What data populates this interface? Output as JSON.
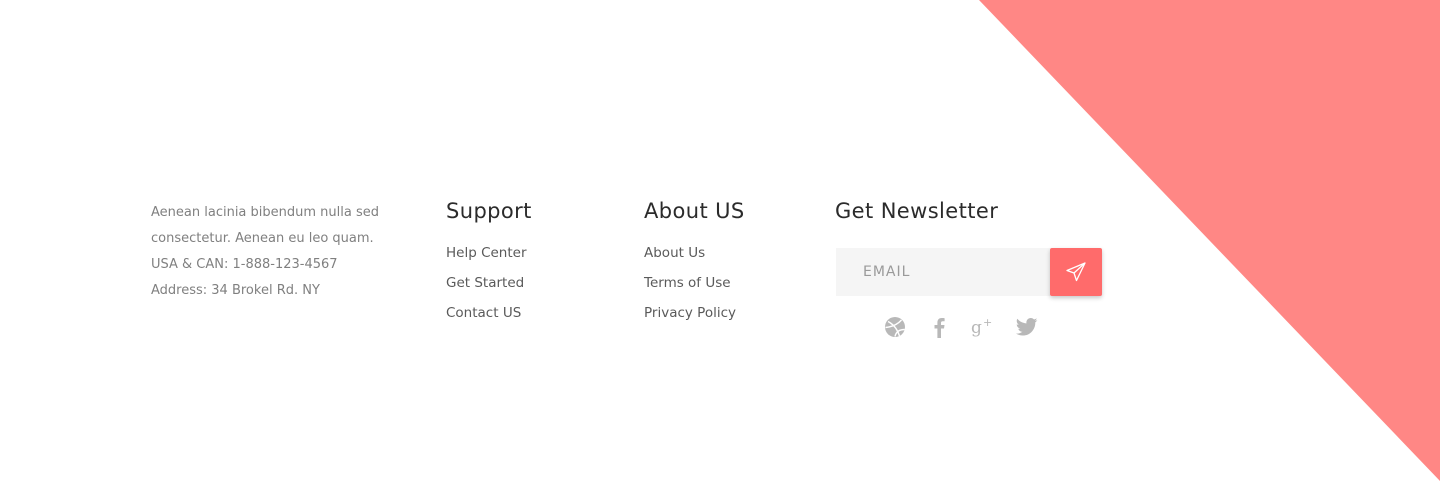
{
  "colors": {
    "accent": "#ff8785",
    "send_button": "#ff6b6b",
    "icon_gray": "#b8b8b8"
  },
  "about": {
    "lines": [
      "Aenean lacinia bibendum nulla sed",
      "consectetur. Aenean eu leo quam.",
      "USA &  CAN: 1-888-123-4567",
      "Address: 34 Brokel Rd. NY"
    ]
  },
  "support": {
    "title": "Support",
    "links": [
      "Help Center",
      "Get Started",
      "Contact US"
    ]
  },
  "about_us": {
    "title": "About US",
    "links": [
      "About Us",
      "Terms of Use",
      "Privacy Policy"
    ]
  },
  "newsletter": {
    "title": "Get Newsletter",
    "email_placeholder": "EMAIL",
    "send_icon": "paper-plane-icon",
    "social": [
      "dribbble-icon",
      "facebook-icon",
      "google-plus-icon",
      "twitter-icon"
    ]
  }
}
